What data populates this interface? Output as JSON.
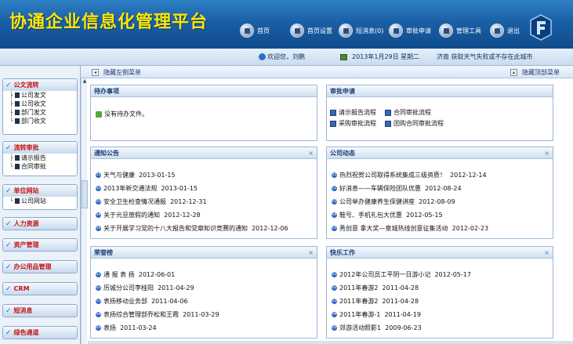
{
  "header": {
    "title": "协通企业信息化管理平台",
    "nav": [
      "首页",
      "首页设置",
      "短消息(0)",
      "审批申请",
      "管理工具",
      "退出"
    ]
  },
  "infobar": {
    "welcome": "欢迎您，刘鹏",
    "date": "2013年1月29日 星期二",
    "weather": "济南 获取天气失败或不存在此城市"
  },
  "subbar": {
    "hide_left": "隐藏左侧菜单",
    "hide_right": "隐藏顶部菜单"
  },
  "sidebar": {
    "groups": [
      {
        "title": "公文流转",
        "items": [
          "公司发文",
          "公司收文",
          "部门发文",
          "部门收文"
        ]
      },
      {
        "title": "流转审批",
        "items": [
          "请示报告",
          "合同审批"
        ]
      },
      {
        "title": "单位网站",
        "items": [
          "公司网站"
        ]
      },
      {
        "title": "人力资源",
        "items": []
      },
      {
        "title": "资产管理",
        "items": []
      },
      {
        "title": "办公用品管理",
        "items": []
      },
      {
        "title": "CRM",
        "items": []
      },
      {
        "title": "短消息",
        "items": []
      },
      {
        "title": "绿色通道",
        "items": []
      }
    ]
  },
  "panels": {
    "todo": {
      "title": "待办事项",
      "empty": "没有待办文件。"
    },
    "approval": {
      "title": "审批申请",
      "links": [
        "请示报告流程",
        "合同审批流程",
        "采购审批流程",
        "团购合同审批流程"
      ]
    },
    "notice": {
      "title": "通知公告",
      "close": "×",
      "items": [
        {
          "text": "天气与健康",
          "date": "2013-01-15"
        },
        {
          "text": "2013年新交通法规",
          "date": "2013-01-15"
        },
        {
          "text": "安全卫生检查情况通报",
          "date": "2012-12-31"
        },
        {
          "text": "关于元旦放假的通知",
          "date": "2012-12-28"
        },
        {
          "text": "关于开展学习党的十八大报告和党章知识竞赛的通知",
          "date": "2012-12-06"
        }
      ]
    },
    "news": {
      "title": "公司动态",
      "close": "×",
      "items": [
        {
          "text": "热烈祝贺公司取得系统集成三级资质！",
          "date": "2012-12-14"
        },
        {
          "text": "好消息——车辆保险团队优惠",
          "date": "2012-08-24"
        },
        {
          "text": "公司举办健康养生保健讲座",
          "date": "2012-08-09"
        },
        {
          "text": "鞋号、手机礼包大优惠",
          "date": "2012-05-15"
        },
        {
          "text": "秀创意 拿大奖—泉城热线创意征集活动",
          "date": "2012-02-23"
        }
      ]
    },
    "honor": {
      "title": "荣誉榜",
      "close": "×",
      "items": [
        {
          "text": "通 报 表 扬",
          "date": "2012-06-01"
        },
        {
          "text": "历城分公司李桂阳",
          "date": "2011-04-29"
        },
        {
          "text": "表扬移动业务部",
          "date": "2011-04-06"
        },
        {
          "text": "表扬综合管理部乔松和王霞",
          "date": "2011-03-29"
        },
        {
          "text": "表扬",
          "date": "2011-03-24"
        }
      ]
    },
    "happy": {
      "title": "快乐工作",
      "close": "×",
      "items": [
        {
          "text": "2012年公司员工平阴一日游小记",
          "date": "2012-05-17"
        },
        {
          "text": "2011年春游2",
          "date": "2011-04-28"
        },
        {
          "text": "2011年春游2",
          "date": "2011-04-28"
        },
        {
          "text": "2011年春游-1",
          "date": "2011-04-19"
        },
        {
          "text": "郊游活动照影1",
          "date": "2009-06-23"
        }
      ]
    }
  }
}
